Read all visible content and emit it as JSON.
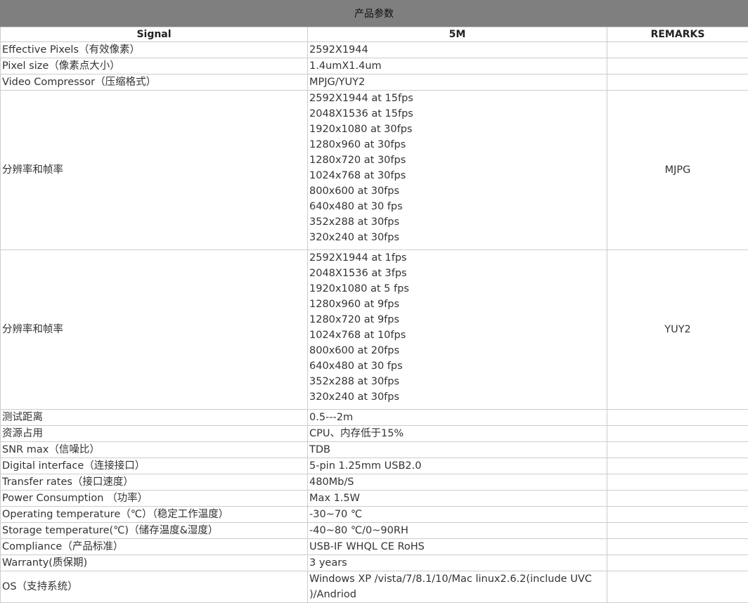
{
  "banner": {
    "title": "产品参数"
  },
  "header": {
    "col1": "Signal",
    "col2": "5M",
    "col3": "REMARKS"
  },
  "rows_top": [
    {
      "label": "Effective Pixels（有效像素）",
      "value": "2592X1944",
      "remark": ""
    },
    {
      "label": "Pixel size（像素点大小）",
      "value": "1.4umX1.4um",
      "remark": ""
    },
    {
      "label": "Video Compressor（压缩格式）",
      "value": "MPJG/YUY2",
      "remark": ""
    }
  ],
  "mjpg": {
    "label": "分辨率和帧率",
    "remark": "MJPG",
    "lines": [
      "2592X1944  at 15fps",
      "2048X1536 at 15fps",
      "1920x1080 at 30fps",
      "1280x960 at 30fps",
      "1280x720 at 30fps",
      "1024x768 at 30fps",
      "800x600 at 30fps",
      "640x480 at 30 fps",
      "352x288 at 30fps",
      "320x240 at 30fps"
    ]
  },
  "yuy2": {
    "label": "分辨率和帧率",
    "remark": "YUY2",
    "lines": [
      "2592X1944  at 1fps",
      "2048X1536 at 3fps",
      "1920x1080 at 5 fps",
      "1280x960 at 9fps",
      "1280x720 at 9fps",
      "1024x768 at 10fps",
      "800x600 at 20fps",
      "640x480 at 30 fps",
      "352x288 at 30fps",
      "320x240 at 30fps"
    ]
  },
  "rows_bottom": [
    {
      "label": "测试距离",
      "value": "0.5---2m",
      "remark": ""
    },
    {
      "label": "资源占用",
      "value": "CPU、内存低于15%",
      "remark": ""
    },
    {
      "label": "SNR max（信噪比）",
      "value": "TDB",
      "remark": ""
    },
    {
      "label": "Digital interface（连接接口）",
      "value": "5-pin 1.25mm USB2.0",
      "remark": ""
    },
    {
      "label": "Transfer rates（接口速度）",
      "value": "480Mb/S",
      "remark": ""
    },
    {
      "label": "Power Consumption （功率）",
      "value": "Max 1.5W",
      "remark": ""
    },
    {
      "label": "Operating temperature（℃）（稳定工作温度）",
      "value": "-30~70 ℃",
      "remark": ""
    },
    {
      "label": "Storage temperature(℃)（储存温度&湿度）",
      "value": "-40~80 ℃/0~90RH",
      "remark": ""
    },
    {
      "label": "Compliance（产品标准）",
      "value": "USB-IF WHQL CE RoHS",
      "remark": ""
    },
    {
      "label": "Warranty(质保期)",
      "value": "3 years",
      "remark": ""
    }
  ],
  "os": {
    "label": "OS（支持系统）",
    "value": "Windows XP /vista/7/8.1/10/Mac linux2.6.2(include UVC )/Andriod",
    "remark": ""
  }
}
